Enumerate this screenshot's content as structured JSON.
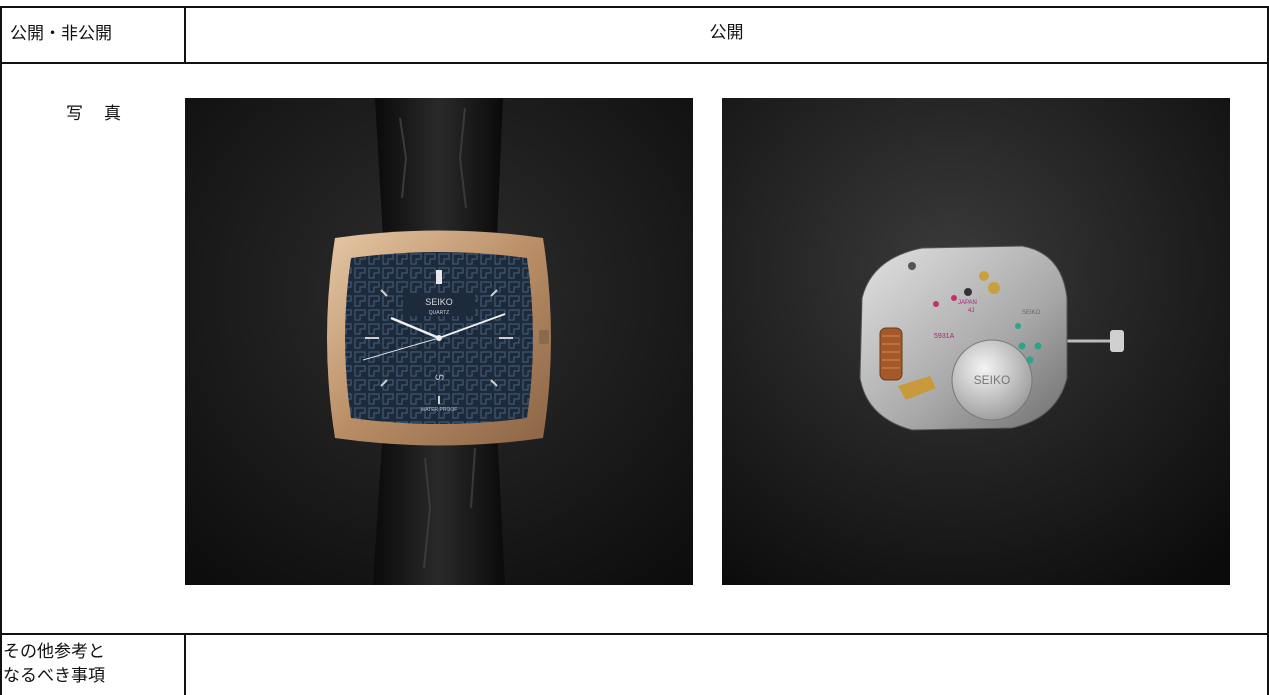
{
  "row_disclosure": {
    "label": "公開・非公開",
    "value": "公開"
  },
  "row_photos": {
    "label": "写　真",
    "photos": [
      {
        "subject": "watch-front",
        "dial_text_1": "SEIKO",
        "dial_text_2": "QUARTZ",
        "dial_text_3": "WATER PROOF"
      },
      {
        "subject": "quartz-movement",
        "engraving_1": "JAPAN",
        "engraving_2": "4J",
        "engraving_3": "5931A",
        "battery_text": "SEIKO",
        "brand": "SEIKO"
      }
    ]
  },
  "row_notes": {
    "label_line1": "その他参考と",
    "label_line2": "なるべき事項",
    "value": ""
  },
  "colors": {
    "border": "#111111",
    "photo_bg": "#151515",
    "gold": "#c9a27a",
    "dial": "#1c2a3c"
  }
}
